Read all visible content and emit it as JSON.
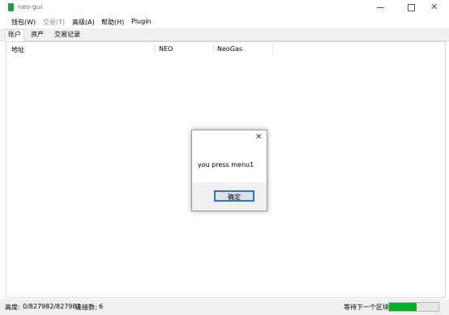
{
  "window": {
    "title": "neo-gui"
  },
  "menu": {
    "items": [
      {
        "label": "钱包(W)",
        "enabled": true
      },
      {
        "label": "交易(T)",
        "enabled": false
      },
      {
        "label": "高级(A)",
        "enabled": true
      },
      {
        "label": "帮助(H)",
        "enabled": true
      },
      {
        "label": "Plugin",
        "enabled": true
      }
    ]
  },
  "tabs": [
    {
      "label": "账户",
      "active": true
    },
    {
      "label": "资产",
      "active": false
    },
    {
      "label": "交易记录",
      "active": false
    }
  ],
  "table": {
    "columns": [
      "地址",
      "NEO",
      "NeoGas"
    ],
    "rows": []
  },
  "status": {
    "height_label": "高度:",
    "height_value": "0/827982/827982",
    "connections_label": "连接数:",
    "connections_value": "6",
    "waiting_label": "等待下一个区块:",
    "progress_fraction": 0.55
  },
  "dialog": {
    "message": "you press menu1",
    "ok_label": "确定"
  },
  "colors": {
    "progress_fill": "#06b025",
    "app_icon": "#1f9d3a",
    "focus_border": "#2a74d2"
  }
}
